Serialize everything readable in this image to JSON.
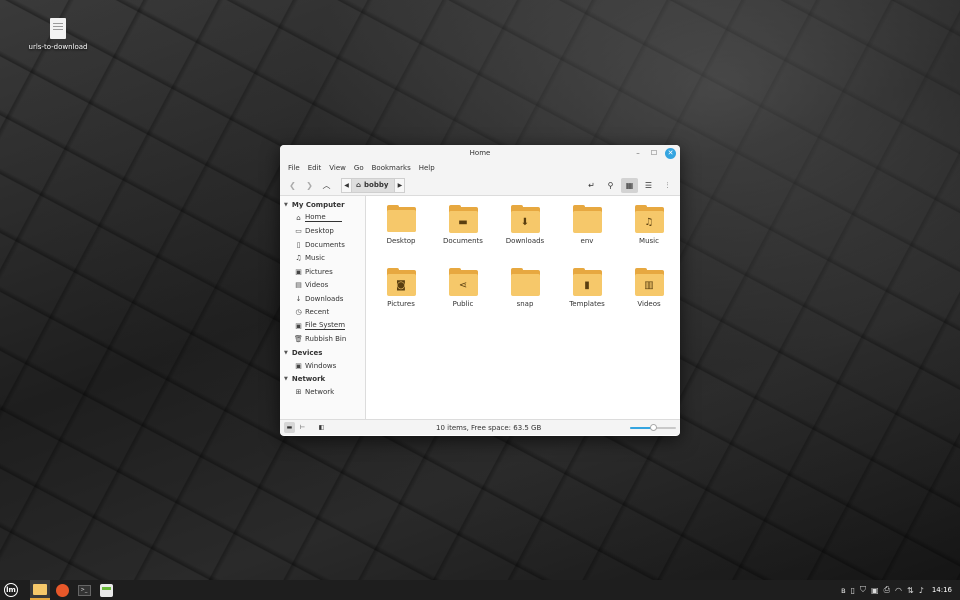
{
  "desktop": {
    "icons": [
      {
        "label": "urls-to-download",
        "icon": "text-file-icon"
      }
    ]
  },
  "window": {
    "title": "Home",
    "menu": [
      "File",
      "Edit",
      "View",
      "Go",
      "Bookmarks",
      "Help"
    ],
    "path": {
      "current": "bobby"
    },
    "sidebar": {
      "sections": [
        {
          "title": "My Computer",
          "items": [
            {
              "label": "Home",
              "icon": "home-icon"
            },
            {
              "label": "Desktop",
              "icon": "desktop-icon"
            },
            {
              "label": "Documents",
              "icon": "documents-icon"
            },
            {
              "label": "Music",
              "icon": "music-icon"
            },
            {
              "label": "Pictures",
              "icon": "pictures-icon"
            },
            {
              "label": "Videos",
              "icon": "videos-icon"
            },
            {
              "label": "Downloads",
              "icon": "downloads-icon"
            },
            {
              "label": "Recent",
              "icon": "recent-icon"
            },
            {
              "label": "File System",
              "icon": "filesystem-icon"
            },
            {
              "label": "Rubbish Bin",
              "icon": "trash-icon"
            }
          ]
        },
        {
          "title": "Devices",
          "items": [
            {
              "label": "Windows",
              "icon": "drive-icon"
            }
          ]
        },
        {
          "title": "Network",
          "items": [
            {
              "label": "Network",
              "icon": "network-icon"
            }
          ]
        }
      ]
    },
    "files": [
      {
        "name": "Desktop",
        "emblem": ""
      },
      {
        "name": "Documents",
        "emblem": "document"
      },
      {
        "name": "Downloads",
        "emblem": "download"
      },
      {
        "name": "env",
        "emblem": ""
      },
      {
        "name": "Music",
        "emblem": "music"
      },
      {
        "name": "Pictures",
        "emblem": "camera"
      },
      {
        "name": "Public",
        "emblem": "share"
      },
      {
        "name": "snap",
        "emblem": ""
      },
      {
        "name": "Templates",
        "emblem": "template"
      },
      {
        "name": "Videos",
        "emblem": "film"
      }
    ],
    "status": "10 items, Free space: 63.5 GB",
    "zoom_level": 0.5,
    "accent": "#35a5e0",
    "folder_color": "#f6c86a"
  },
  "taskbar": {
    "apps": [
      "menu",
      "files",
      "firefox",
      "terminal",
      "update-manager"
    ],
    "clock": "14:16"
  }
}
